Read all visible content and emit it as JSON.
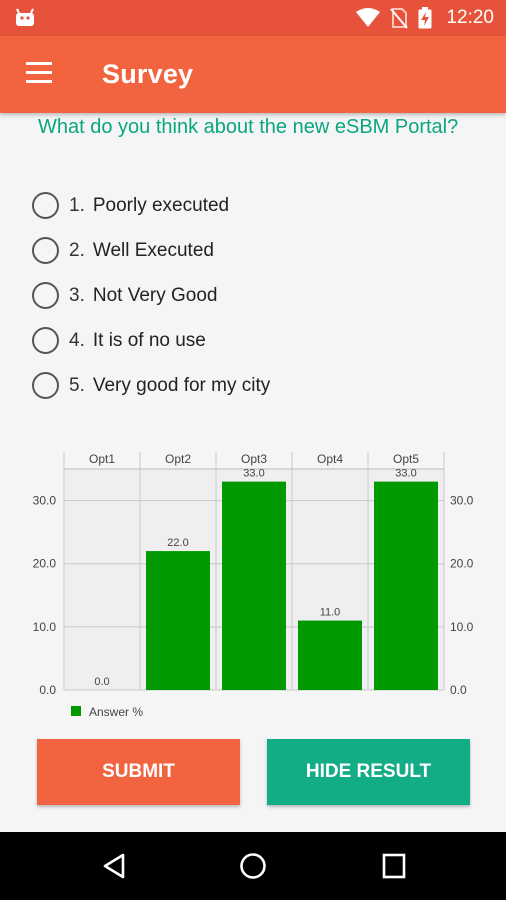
{
  "status_bar": {
    "time": "12:20",
    "icons": [
      "android-icon",
      "wifi-icon",
      "no-sim-icon",
      "battery-charging-icon"
    ]
  },
  "app_bar": {
    "title": "Survey",
    "menu_icon": "menu-icon"
  },
  "survey": {
    "question": "What do you think about the new eSBM Portal?",
    "options": [
      {
        "num": "1.",
        "label": "Poorly executed"
      },
      {
        "num": "2.",
        "label": "Well Executed"
      },
      {
        "num": "3.",
        "label": "Not Very Good"
      },
      {
        "num": "4.",
        "label": "It is of no use"
      },
      {
        "num": "5.",
        "label": "Very good for my city"
      }
    ]
  },
  "chart_data": {
    "type": "bar",
    "categories": [
      "Opt1",
      "Opt2",
      "Opt3",
      "Opt4",
      "Opt5"
    ],
    "series": [
      {
        "name": "Answer %",
        "values": [
          0.0,
          22.0,
          33.0,
          11.0,
          33.0
        ],
        "color": "#009900"
      }
    ],
    "value_labels": [
      "0.0",
      "22.0",
      "33.0",
      "11.0",
      "33.0"
    ],
    "y_ticks": [
      "0.0",
      "10.0",
      "20.0",
      "30.0"
    ],
    "ylim": [
      0,
      35
    ],
    "grid": true,
    "legend_position": "bottom-left",
    "category_axis_position": "top",
    "y_axis_both_sides": true
  },
  "buttons": {
    "submit": "SUBMIT",
    "hide_result": "HIDE RESULT"
  },
  "colors": {
    "primary": "#f26440",
    "status_bar": "#e6533a",
    "accent": "#12ad86",
    "question_text": "#0aa680",
    "bar": "#009900"
  },
  "nav_bar": {
    "icons": [
      "back-icon",
      "home-icon",
      "recents-icon"
    ]
  }
}
